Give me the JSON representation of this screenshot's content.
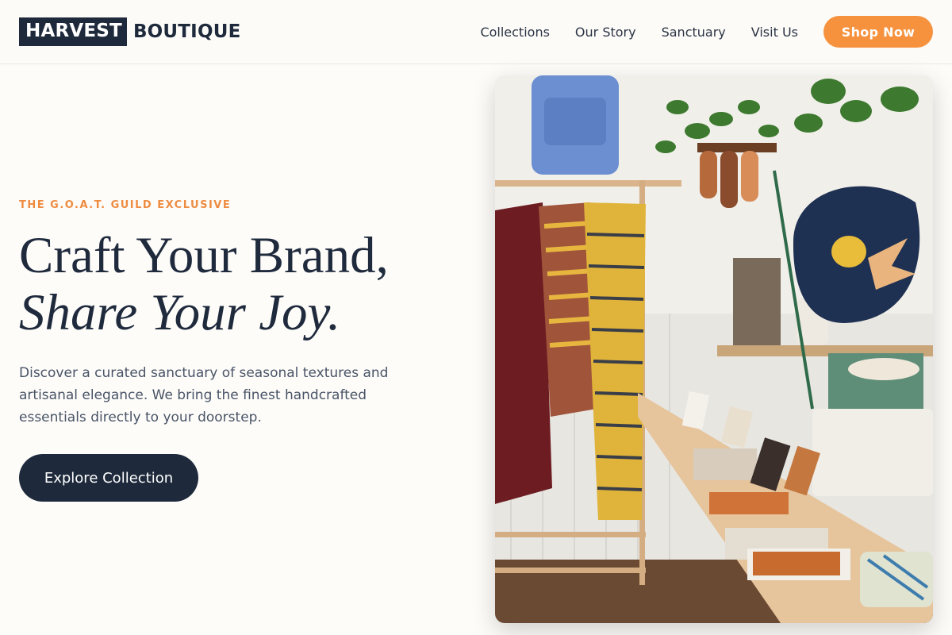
{
  "header": {
    "logo_box": "HARVEST",
    "logo_text": "BOUTIQUE",
    "nav": [
      {
        "label": "Collections"
      },
      {
        "label": "Our Story"
      },
      {
        "label": "Sanctuary"
      },
      {
        "label": "Visit Us"
      }
    ],
    "cta_label": "Shop Now"
  },
  "hero": {
    "eyebrow": "THE G.O.A.T. GUILD EXCLUSIVE",
    "headline_line1": "Craft Your Brand,",
    "headline_line2": "Share Your Joy.",
    "description": "Discover a curated sanctuary of seasonal textures and artisanal elegance. We bring the finest handcrafted essentials directly to your doorstep.",
    "button_label": "Explore Collection",
    "image_subject": "boutique-interior-photo"
  },
  "colors": {
    "navy": "#1e2a3c",
    "accent_orange": "#f6923e",
    "background": "#fdfcf9"
  }
}
